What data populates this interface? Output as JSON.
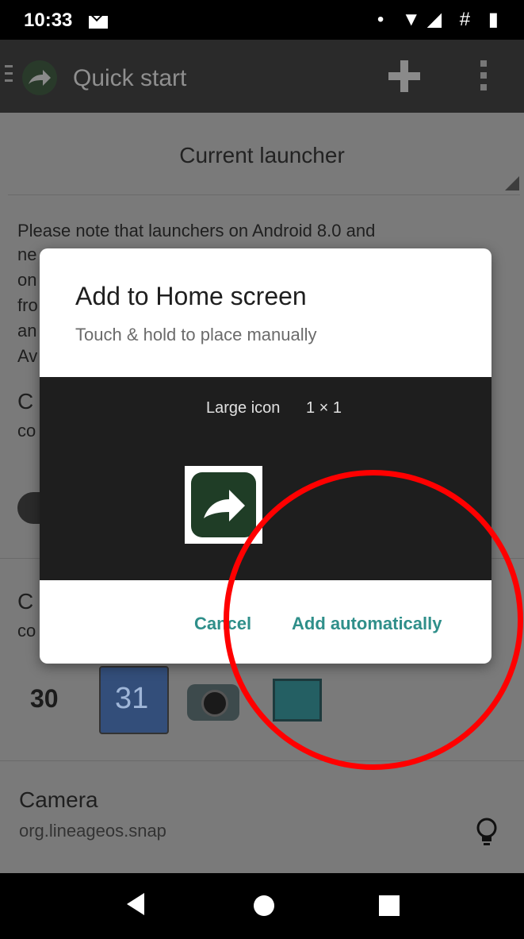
{
  "status_bar": {
    "time": "10:33",
    "icons": "• ▼◢ # ▮"
  },
  "app_bar": {
    "title": "Quick start"
  },
  "content": {
    "launcher_label": "Current launcher",
    "note": "Please note that launchers on Android 8.0 and",
    "partial_lines": [
      "ne",
      "on",
      "fro",
      "an",
      "Av"
    ],
    "partial_c1": "C",
    "partial_co1": "co",
    "partial_c2": "C",
    "partial_co2": "co",
    "calendar_number": "31",
    "clock_number": "30",
    "camera_title": "Camera",
    "camera_package": "org.lineageos.snap"
  },
  "dialog": {
    "title": "Add to Home screen",
    "subtitle": "Touch & hold to place manually",
    "preview_label": "Large icon",
    "preview_size": "1 × 1",
    "cancel": "Cancel",
    "add": "Add automatically"
  },
  "annotation": {
    "color": "#ff0000"
  }
}
